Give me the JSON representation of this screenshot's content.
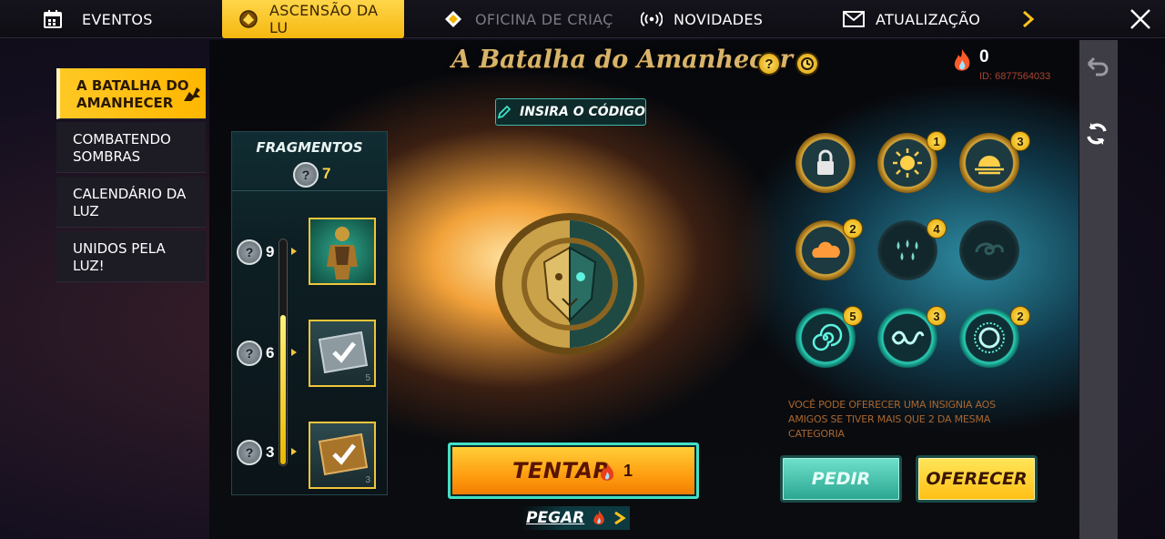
{
  "tabs": [
    {
      "label": "EVENTOS",
      "icon": "calendar-icon"
    },
    {
      "label": "ASCENSÃO DA LU",
      "icon": "emblem-icon"
    },
    {
      "label": "OFICINA DE CRIAÇ",
      "icon": "diamond-icon"
    },
    {
      "label": "NOVIDADES",
      "icon": "broadcast-icon"
    },
    {
      "label": "ATUALIZAÇÃO",
      "icon": "mail-icon"
    }
  ],
  "sidebar": {
    "items": [
      {
        "label": "A BATALHA DO AMANHECER",
        "active": true
      },
      {
        "label": "COMBATENDO SOMBRAS",
        "active": false
      },
      {
        "label": "CALENDÁRIO DA LUZ",
        "active": false
      },
      {
        "label": "UNIDOS PELA LUZ!",
        "active": false
      }
    ]
  },
  "event": {
    "title": "A Batalha do Amanhecer",
    "help_icon": "?",
    "code_button": "INSIRA O CÓDIGO",
    "currency_value": "0",
    "player_id": "ID: 6877564033"
  },
  "fragments": {
    "title": "FRAGMENTOS",
    "owned": "7",
    "progress_fraction": 0.66,
    "rewards": [
      {
        "required": "9",
        "type": "character",
        "qty": ""
      },
      {
        "required": "6",
        "type": "ticket",
        "qty": "5"
      },
      {
        "required": "3",
        "type": "ticket",
        "qty": "3"
      }
    ]
  },
  "badges": [
    {
      "icon": "lock-icon",
      "count": "",
      "style": "gold"
    },
    {
      "icon": "sun-icon",
      "count": "1",
      "style": "gold"
    },
    {
      "icon": "sunrise-icon",
      "count": "3",
      "style": "gold"
    },
    {
      "icon": "cloud-icon",
      "count": "2",
      "style": "gold"
    },
    {
      "icon": "drops-icon",
      "count": "4",
      "style": "dark"
    },
    {
      "icon": "swirl-icon",
      "count": "",
      "style": "dark"
    },
    {
      "icon": "spiral-icon",
      "count": "5",
      "style": "teal"
    },
    {
      "icon": "wave-icon",
      "count": "3",
      "style": "teal"
    },
    {
      "icon": "burst-icon",
      "count": "2",
      "style": "teal"
    }
  ],
  "hint": "VOCÊ PODE OFERECER UMA INSIGNIA AOS AMIGOS SE TIVER MAIS QUE 2 DA MESMA CATEGORIA",
  "actions": {
    "try_label": "TENTAR",
    "try_cost": "1",
    "get_label": "PEGAR",
    "ask_label": "PEDIR",
    "offer_label": "OFERECER"
  },
  "colors": {
    "accent_gold": "#ffc824",
    "accent_teal": "#43e0c6",
    "flame": "#ff5a2a"
  }
}
